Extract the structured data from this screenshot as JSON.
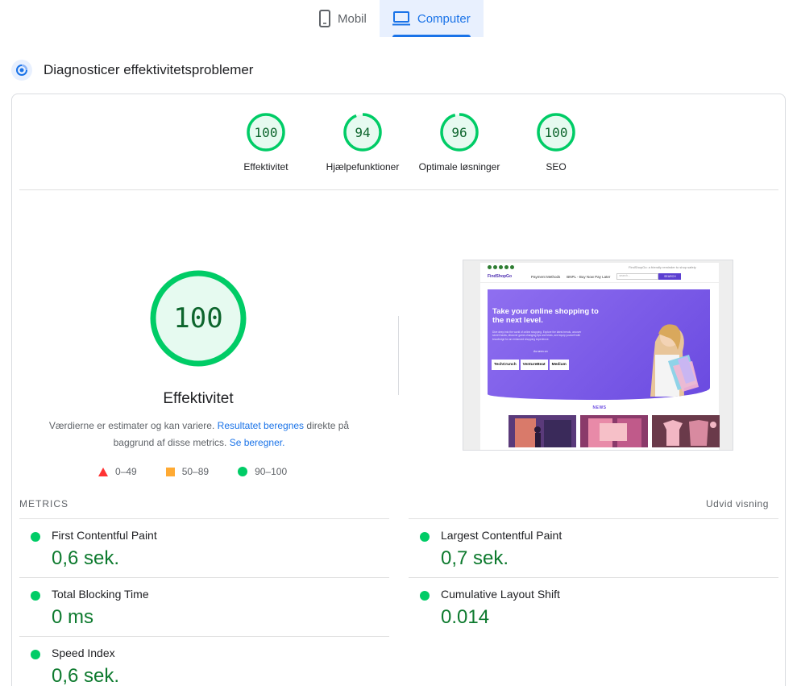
{
  "tabs": [
    {
      "label": "Mobil",
      "icon": "phone-icon",
      "active": false
    },
    {
      "label": "Computer",
      "icon": "desktop-icon",
      "active": true
    }
  ],
  "section": {
    "title": "Diagnosticer effektivitetsproblemer",
    "icon": "diagnose-icon"
  },
  "categories": [
    {
      "score": "100",
      "label": "Effektivitet",
      "value": 1.0
    },
    {
      "score": "94",
      "label": "Hjælpefunktioner",
      "value": 0.94
    },
    {
      "score": "96",
      "label": "Optimale løsninger",
      "value": 0.96
    },
    {
      "score": "100",
      "label": "SEO",
      "value": 1.0
    }
  ],
  "performance": {
    "score": "100",
    "value": 1.0,
    "label": "Effektivitet",
    "desc_prefix": "Værdierne er estimater og kan variere.",
    "desc_link1": "Resultatet beregnes",
    "desc_middle": "direkte på baggrund af disse metrics.",
    "desc_link2": "Se beregner."
  },
  "legend": [
    {
      "range": "0–49",
      "icon": "fail-triangle-icon",
      "color": "#ff3333"
    },
    {
      "range": "50–89",
      "icon": "average-square-icon",
      "color": "#ffaa33"
    },
    {
      "range": "90–100",
      "icon": "pass-circle-icon",
      "color": "#00cc66"
    }
  ],
  "screenshot": {
    "logo": "FindShopGo",
    "top_notice": "FindShopGo: a friendly reminder to shop safely",
    "nav_payment": "Payment Methods",
    "nav_bnpl": "BNPL - Buy Now Pay Later",
    "search_placeholder": "search...",
    "search_button": "SEARCH",
    "hero_title": "Take your online shopping to the next level.",
    "hero_text": "Dive deep into the world of online shopping. Explore the latest trends, uncover secret hacks, discover game-changing tips and tricks, and equip yourself with knowledge for an enhanced shopping experience.",
    "seen_on": "As seen on",
    "press": [
      "TechCrunch",
      "VentureBeat",
      "Medium"
    ],
    "news_label": "NEWS"
  },
  "metrics": {
    "title": "METRICS",
    "expand_label": "Udvid visning",
    "items": [
      {
        "name": "First Contentful Paint",
        "value": "0,6 sek."
      },
      {
        "name": "Largest Contentful Paint",
        "value": "0,7 sek."
      },
      {
        "name": "Total Blocking Time",
        "value": "0 ms"
      },
      {
        "name": "Cumulative Layout Shift",
        "value": "0.014"
      },
      {
        "name": "Speed Index",
        "value": "0,6 sek."
      }
    ]
  },
  "colors": {
    "pass": "#00cc66",
    "pass_text": "#0d652d",
    "pass_fill": "#e6faf0",
    "accent": "#1a73e8"
  }
}
